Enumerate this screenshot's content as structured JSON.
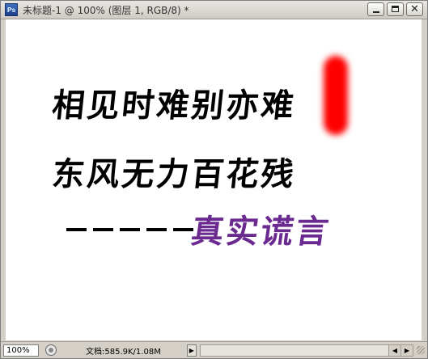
{
  "window": {
    "title": "未标题-1 @ 100% (图层 1, RGB/8) *",
    "app_icon_label": "Ps",
    "controls": {
      "minimize_icon": "minimize-icon",
      "maximize_icon": "maximize-icon",
      "close_glyph": "✕"
    }
  },
  "canvas": {
    "poem_line_1": "相见时难别亦难",
    "poem_line_2": "东风无力百花残",
    "dash_count": 5,
    "attribution": "真实谎言",
    "colors": {
      "text": "#000000",
      "attribution": "#6a2a90",
      "brush": "#ff0000"
    }
  },
  "statusbar": {
    "zoom": "100%",
    "doc_info": "文档:585.9K/1.08M",
    "arrow_glyph": "▶",
    "scroll_left_glyph": "◀",
    "scroll_right_glyph": "▶"
  }
}
